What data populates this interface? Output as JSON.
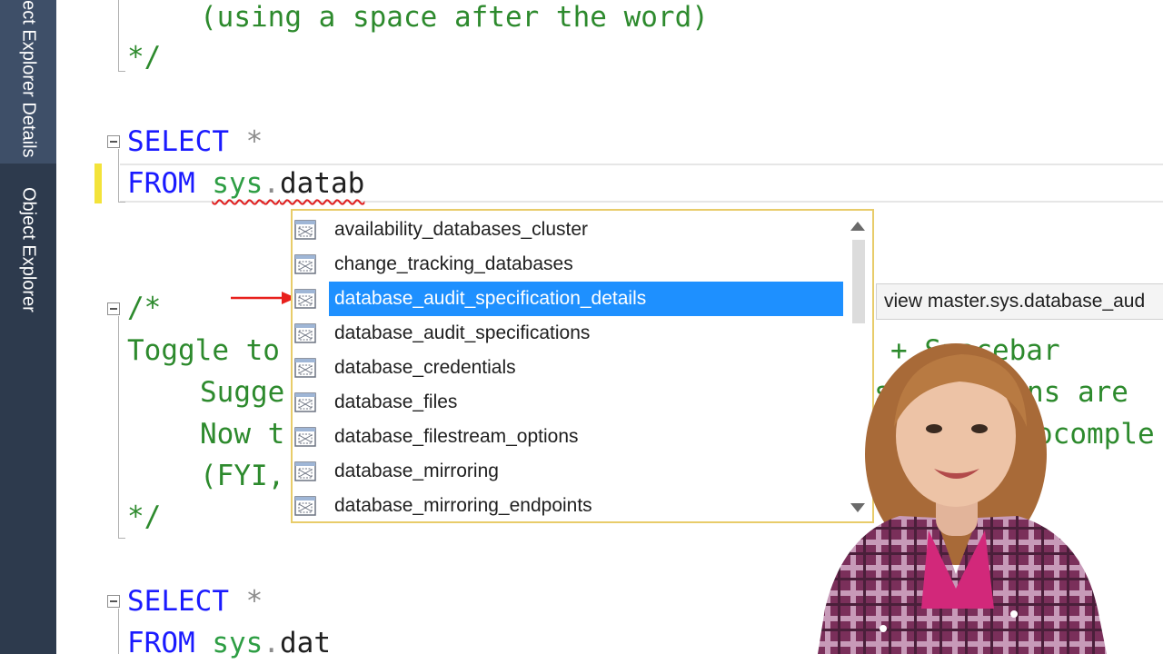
{
  "side_panel": {
    "tabs": [
      {
        "label": "Object Explorer Details"
      },
      {
        "label": "Object Explorer"
      }
    ]
  },
  "editor": {
    "lines": {
      "comment_tail": "(using a space after the word)",
      "comment_close_1": "*/",
      "select_1_keyword": "SELECT",
      "select_1_star": "*",
      "from_1_keyword": "FROM",
      "from_1_sys": "sys",
      "from_1_dot": ".",
      "from_1_typed": "datab",
      "comment_open_2": "/*",
      "toggle_line": "Toggle to",
      "toggle_line_tail": "+ Spacebar",
      "suggest_line": "Sugge",
      "suggest_line_tail": "suggestions are",
      "now_line": "Now t",
      "now_line_tail": "ocomple",
      "fyi_line": "(FYI,",
      "comment_close_2": "*/",
      "select_2_keyword": "SELECT",
      "select_2_star": "*",
      "from_2_keyword": "FROM",
      "from_2_sys": "sys",
      "from_2_dot": ".",
      "from_2_typed": "dat"
    }
  },
  "autocomplete": {
    "items": [
      {
        "label": "availability_databases_cluster",
        "icon": "view-icon"
      },
      {
        "label": "change_tracking_databases",
        "icon": "view-icon"
      },
      {
        "label": "database_audit_specification_details",
        "icon": "view-icon",
        "selected": true
      },
      {
        "label": "database_audit_specifications",
        "icon": "view-icon"
      },
      {
        "label": "database_credentials",
        "icon": "view-icon"
      },
      {
        "label": "database_files",
        "icon": "view-icon"
      },
      {
        "label": "database_filestream_options",
        "icon": "view-icon"
      },
      {
        "label": "database_mirroring",
        "icon": "view-icon"
      },
      {
        "label": "database_mirroring_endpoints",
        "icon": "view-icon"
      }
    ],
    "tooltip": "view master.sys.database_aud"
  },
  "colors": {
    "keyword": "#1a1aff",
    "comment": "#2d8a2d",
    "selection": "#1e90ff",
    "side_panel": "#2d3a4d",
    "arrow": "#e8201c"
  }
}
